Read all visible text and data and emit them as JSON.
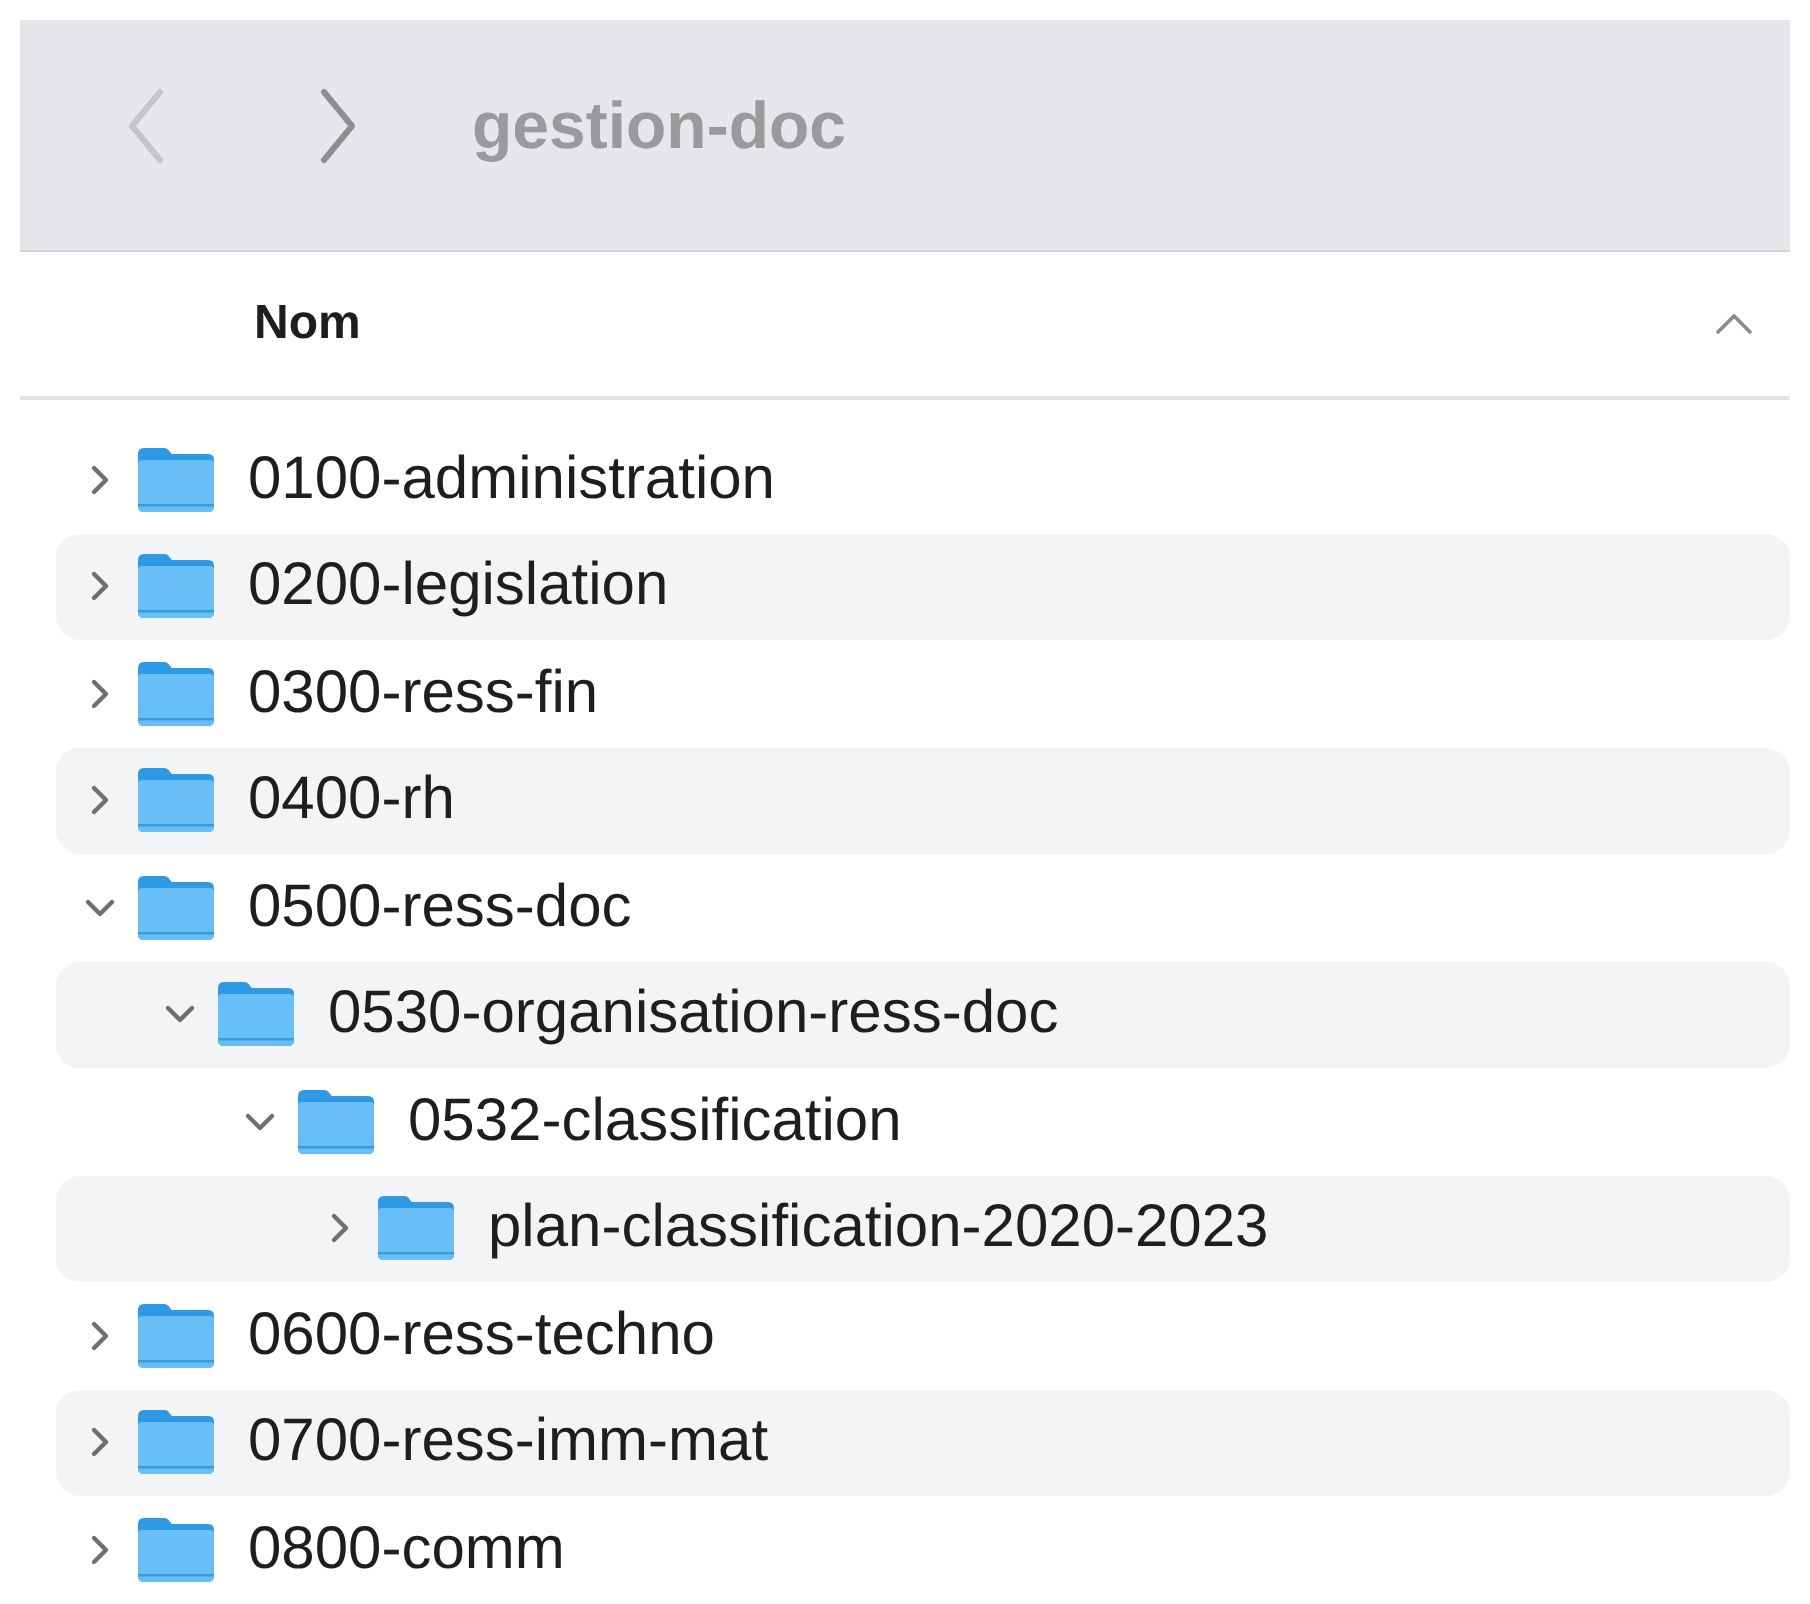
{
  "toolbar": {
    "back": {
      "disabled": true
    },
    "forward": {
      "disabled": false
    },
    "title": "gestion-doc"
  },
  "list": {
    "column": {
      "label": "Nom",
      "ascending": true
    },
    "items": [
      {
        "name": "0100-administration",
        "expanded": false
      },
      {
        "name": "0200-legislation",
        "expanded": false
      },
      {
        "name": "0300-ress-fin",
        "expanded": false
      },
      {
        "name": "0400-rh",
        "expanded": false
      },
      {
        "name": "0500-ress-doc",
        "expanded": true,
        "children": [
          {
            "name": "0530-organisation-ress-doc",
            "expanded": true,
            "children": [
              {
                "name": "0532-classification",
                "expanded": true,
                "children": [
                  {
                    "name": "plan-classification-2020-2023",
                    "expanded": false
                  }
                ]
              }
            ]
          }
        ]
      },
      {
        "name": "0600-ress-techno",
        "expanded": false
      },
      {
        "name": "0700-ress-imm-mat",
        "expanded": false
      },
      {
        "name": "0800-comm",
        "expanded": false
      }
    ]
  }
}
